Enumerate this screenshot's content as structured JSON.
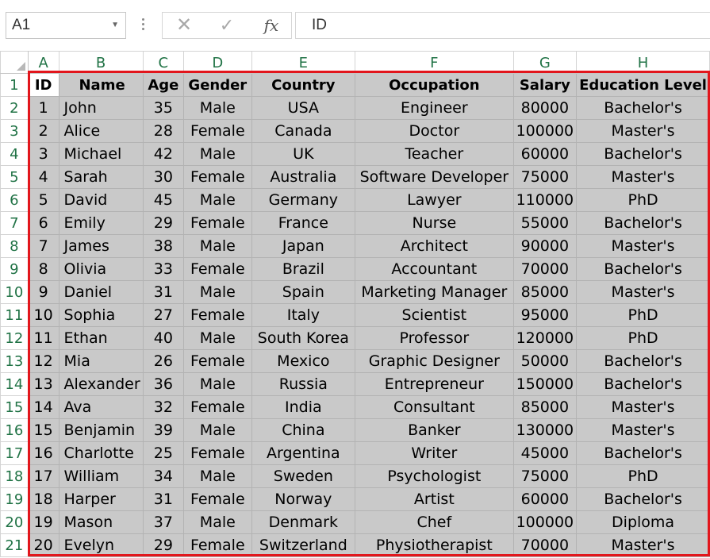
{
  "formula_bar": {
    "name_box": "A1",
    "cancel_icon": "✕",
    "enter_icon": "✓",
    "fx_label": "fx",
    "formula_value": "ID"
  },
  "sheet": {
    "column_letters": [
      "A",
      "B",
      "C",
      "D",
      "E",
      "F",
      "G",
      "H"
    ],
    "row_numbers": [
      "1",
      "2",
      "3",
      "4",
      "5",
      "6",
      "7",
      "8",
      "9",
      "10",
      "11",
      "12",
      "13",
      "14",
      "15",
      "16",
      "17",
      "18",
      "19",
      "20",
      "21"
    ],
    "headers": [
      "ID",
      "Name",
      "Age",
      "Gender",
      "Country",
      "Occupation",
      "Salary",
      "Education Level"
    ],
    "rows": [
      [
        "1",
        "John",
        "35",
        "Male",
        "USA",
        "Engineer",
        "80000",
        "Bachelor's"
      ],
      [
        "2",
        "Alice",
        "28",
        "Female",
        "Canada",
        "Doctor",
        "100000",
        "Master's"
      ],
      [
        "3",
        "Michael",
        "42",
        "Male",
        "UK",
        "Teacher",
        "60000",
        "Bachelor's"
      ],
      [
        "4",
        "Sarah",
        "30",
        "Female",
        "Australia",
        "Software Developer",
        "75000",
        "Master's"
      ],
      [
        "5",
        "David",
        "45",
        "Male",
        "Germany",
        "Lawyer",
        "110000",
        "PhD"
      ],
      [
        "6",
        "Emily",
        "29",
        "Female",
        "France",
        "Nurse",
        "55000",
        "Bachelor's"
      ],
      [
        "7",
        "James",
        "38",
        "Male",
        "Japan",
        "Architect",
        "90000",
        "Master's"
      ],
      [
        "8",
        "Olivia",
        "33",
        "Female",
        "Brazil",
        "Accountant",
        "70000",
        "Bachelor's"
      ],
      [
        "9",
        "Daniel",
        "31",
        "Male",
        "Spain",
        "Marketing Manager",
        "85000",
        "Master's"
      ],
      [
        "10",
        "Sophia",
        "27",
        "Female",
        "Italy",
        "Scientist",
        "95000",
        "PhD"
      ],
      [
        "11",
        "Ethan",
        "40",
        "Male",
        "South Korea",
        "Professor",
        "120000",
        "PhD"
      ],
      [
        "12",
        "Mia",
        "26",
        "Female",
        "Mexico",
        "Graphic Designer",
        "50000",
        "Bachelor's"
      ],
      [
        "13",
        "Alexander",
        "36",
        "Male",
        "Russia",
        "Entrepreneur",
        "150000",
        "Bachelor's"
      ],
      [
        "14",
        "Ava",
        "32",
        "Female",
        "India",
        "Consultant",
        "85000",
        "Master's"
      ],
      [
        "15",
        "Benjamin",
        "39",
        "Male",
        "China",
        "Banker",
        "130000",
        "Master's"
      ],
      [
        "16",
        "Charlotte",
        "25",
        "Female",
        "Argentina",
        "Writer",
        "45000",
        "Bachelor's"
      ],
      [
        "17",
        "William",
        "34",
        "Male",
        "Sweden",
        "Psychologist",
        "75000",
        "PhD"
      ],
      [
        "18",
        "Harper",
        "31",
        "Female",
        "Norway",
        "Artist",
        "60000",
        "Bachelor's"
      ],
      [
        "19",
        "Mason",
        "37",
        "Male",
        "Denmark",
        "Chef",
        "100000",
        "Diploma"
      ],
      [
        "20",
        "Evelyn",
        "29",
        "Female",
        "Switzerland",
        "Physiotherapist",
        "70000",
        "Master's"
      ]
    ]
  },
  "colors": {
    "header_text_green": "#217346",
    "selected_fill": "#c9c9c9",
    "selection_outline_red": "#e2161c"
  }
}
